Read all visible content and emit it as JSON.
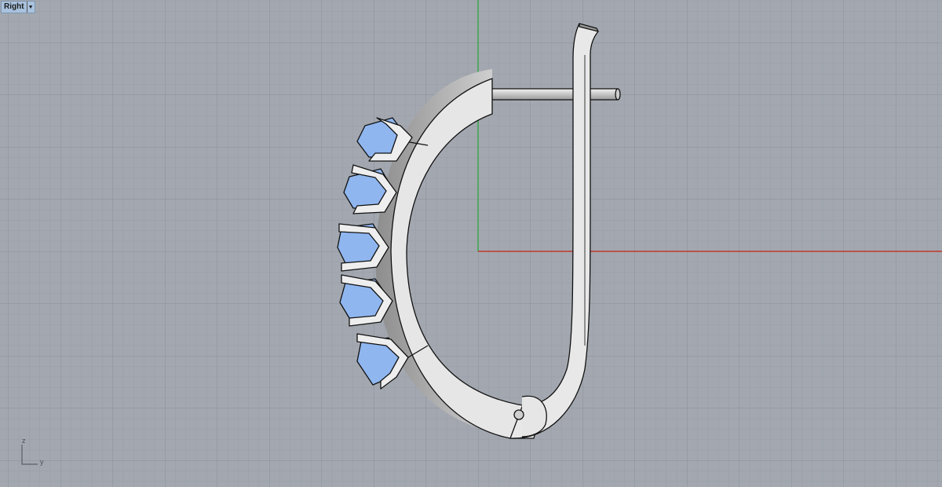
{
  "viewport": {
    "name": "Right",
    "axis_labels": {
      "vertical": "z",
      "horizontal": "y"
    }
  },
  "colors": {
    "background": "#a3a8b0",
    "grid_minor": "#979ca4",
    "grid_major": "#8a8f97",
    "x_axis": "#c0392b",
    "y_axis": "#3aa64a",
    "metal": "#e4e4e4",
    "gem": "#8fb6ef"
  }
}
